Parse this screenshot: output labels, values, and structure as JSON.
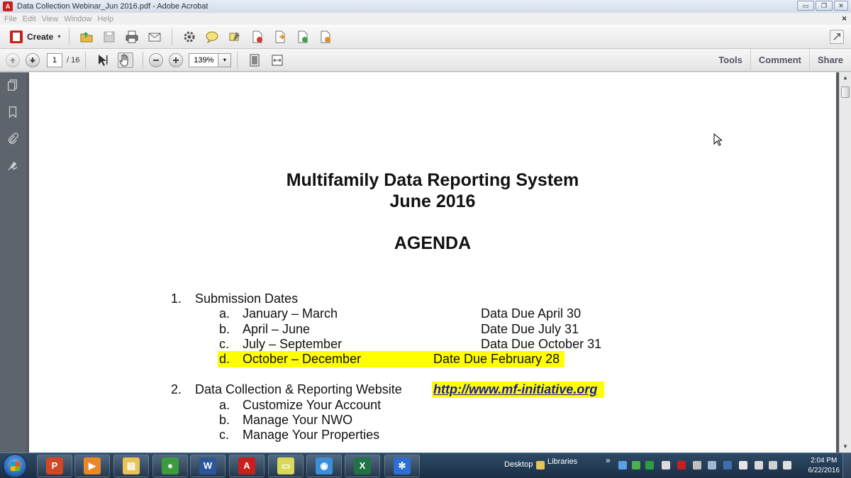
{
  "window": {
    "title": "Data Collection Webinar_Jun 2016.pdf - Adobe Acrobat",
    "minimize_glyph": "▭",
    "restore_glyph": "❐",
    "close_glyph": "✕"
  },
  "menu": {
    "items": [
      "File",
      "Edit",
      "View",
      "Window",
      "Help"
    ],
    "close_glyph": "×"
  },
  "toolbar": {
    "create_label": "Create",
    "caret": "▾"
  },
  "navbar": {
    "current_page": "1",
    "total_pages": "/ 16",
    "zoom": "139%",
    "zoom_caret": "▾",
    "links": [
      "Tools",
      "Comment",
      "Share"
    ]
  },
  "document": {
    "title_line1": "Multifamily Data Reporting System",
    "title_line2": "June 2016",
    "heading": "AGENDA",
    "section1": {
      "number": "1.",
      "title": "Submission Dates",
      "items": [
        {
          "letter": "a.",
          "label": "January – March",
          "due": "Data Due April 30"
        },
        {
          "letter": "b.",
          "label": "April – June",
          "due": "Date Due July 31"
        },
        {
          "letter": "c.",
          "label": "July – September",
          "due": "Data Due October 31"
        },
        {
          "letter": "d.",
          "label": "October – December",
          "due": "Date Due February 28"
        }
      ]
    },
    "section2": {
      "number": "2.",
      "title": "Data Collection & Reporting Website",
      "link": "http://www.mf-initiative.org",
      "items": [
        {
          "letter": "a.",
          "label": "Customize Your Account"
        },
        {
          "letter": "b.",
          "label": "Manage Your NWO"
        },
        {
          "letter": "c.",
          "label": "Manage Your Properties"
        }
      ]
    }
  },
  "scrollbar": {
    "up_glyph": "▲",
    "down_glyph": "▼"
  },
  "taskbar": {
    "apps": [
      {
        "name": "powerpoint",
        "glyph": "P",
        "color": "#d24726"
      },
      {
        "name": "media-player",
        "glyph": "▶",
        "color": "#e9872b"
      },
      {
        "name": "file-explorer",
        "glyph": "▤",
        "color": "#e8c35a"
      },
      {
        "name": "chrome",
        "glyph": "●",
        "color": "#3c9b3c"
      },
      {
        "name": "word",
        "glyph": "W",
        "color": "#2b579a"
      },
      {
        "name": "acrobat",
        "glyph": "A",
        "color": "#c8201c"
      },
      {
        "name": "sticky-notes",
        "glyph": "▭",
        "color": "#d9d85a"
      },
      {
        "name": "messenger",
        "glyph": "◉",
        "color": "#3a8fd6"
      },
      {
        "name": "excel",
        "glyph": "X",
        "color": "#217346"
      },
      {
        "name": "snowflake-app",
        "glyph": "✻",
        "color": "#2d6fd0"
      }
    ],
    "desktop_label": "Desktop",
    "libraries_label": "Libraries",
    "overflow_glyph": "»",
    "time": "2:04 PM",
    "date": "6/22/2016"
  }
}
